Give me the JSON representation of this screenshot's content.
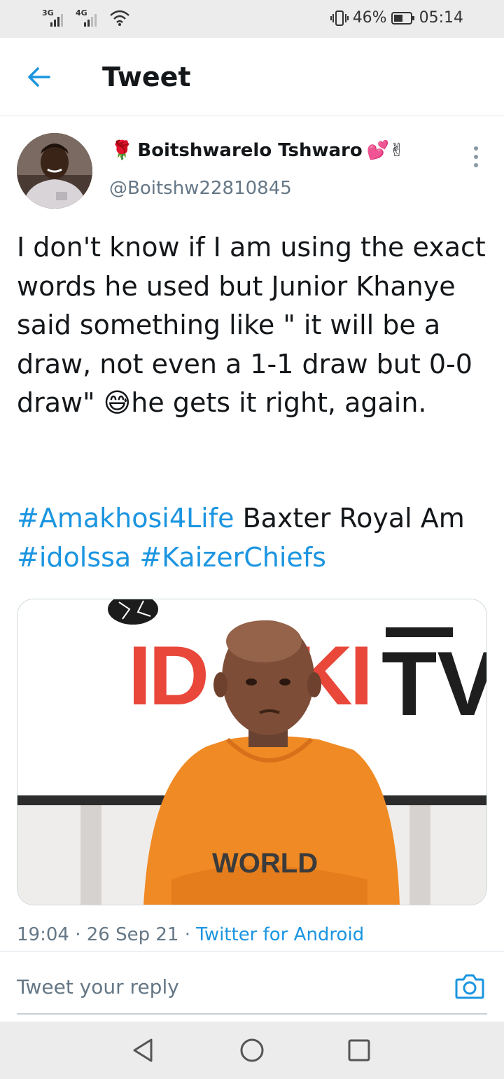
{
  "status_bar": {
    "signal1_label": "3G",
    "signal2_label": "4G",
    "battery_percent": "46%",
    "time": "05:14"
  },
  "header": {
    "title": "Tweet"
  },
  "tweet": {
    "display_name": "Boitshwarelo Tshwaro",
    "name_prefix_emoji": "🌹",
    "name_suffix_emoji": "💕✌",
    "handle": "@Boitshw22810845",
    "text": "I don't know if I am using the exact words he used but Junior Khanye said something like \" it will be a draw, not even a 1-1 draw but 0-0 draw\" 😅he gets it right, again.",
    "hashtag1": "#Amakhosi4Life",
    "mid_text": " Baxter Royal Am ",
    "hashtag2": "#idolssa",
    "hashtag3": "#KaizerChiefs",
    "time": "19:04",
    "date": "26 Sep 21",
    "source": "Twitter for Android"
  },
  "media": {
    "sign_left": "ID",
    "sign_right": "KI",
    "sign_tv": "TV",
    "hoodie_text": "WORLD"
  },
  "reply": {
    "placeholder": "Tweet your reply"
  },
  "icons": {
    "back": "arrow-left-icon",
    "more": "more-vertical-icon",
    "camera": "camera-icon",
    "nav_back": "triangle-back-icon",
    "nav_home": "circle-home-icon",
    "nav_recents": "square-recents-icon"
  },
  "colors": {
    "accent": "#1b95e0",
    "text": "#14171a",
    "secondary": "#657786",
    "hoodie": "#f08a24",
    "sign_red": "#e8473a"
  }
}
